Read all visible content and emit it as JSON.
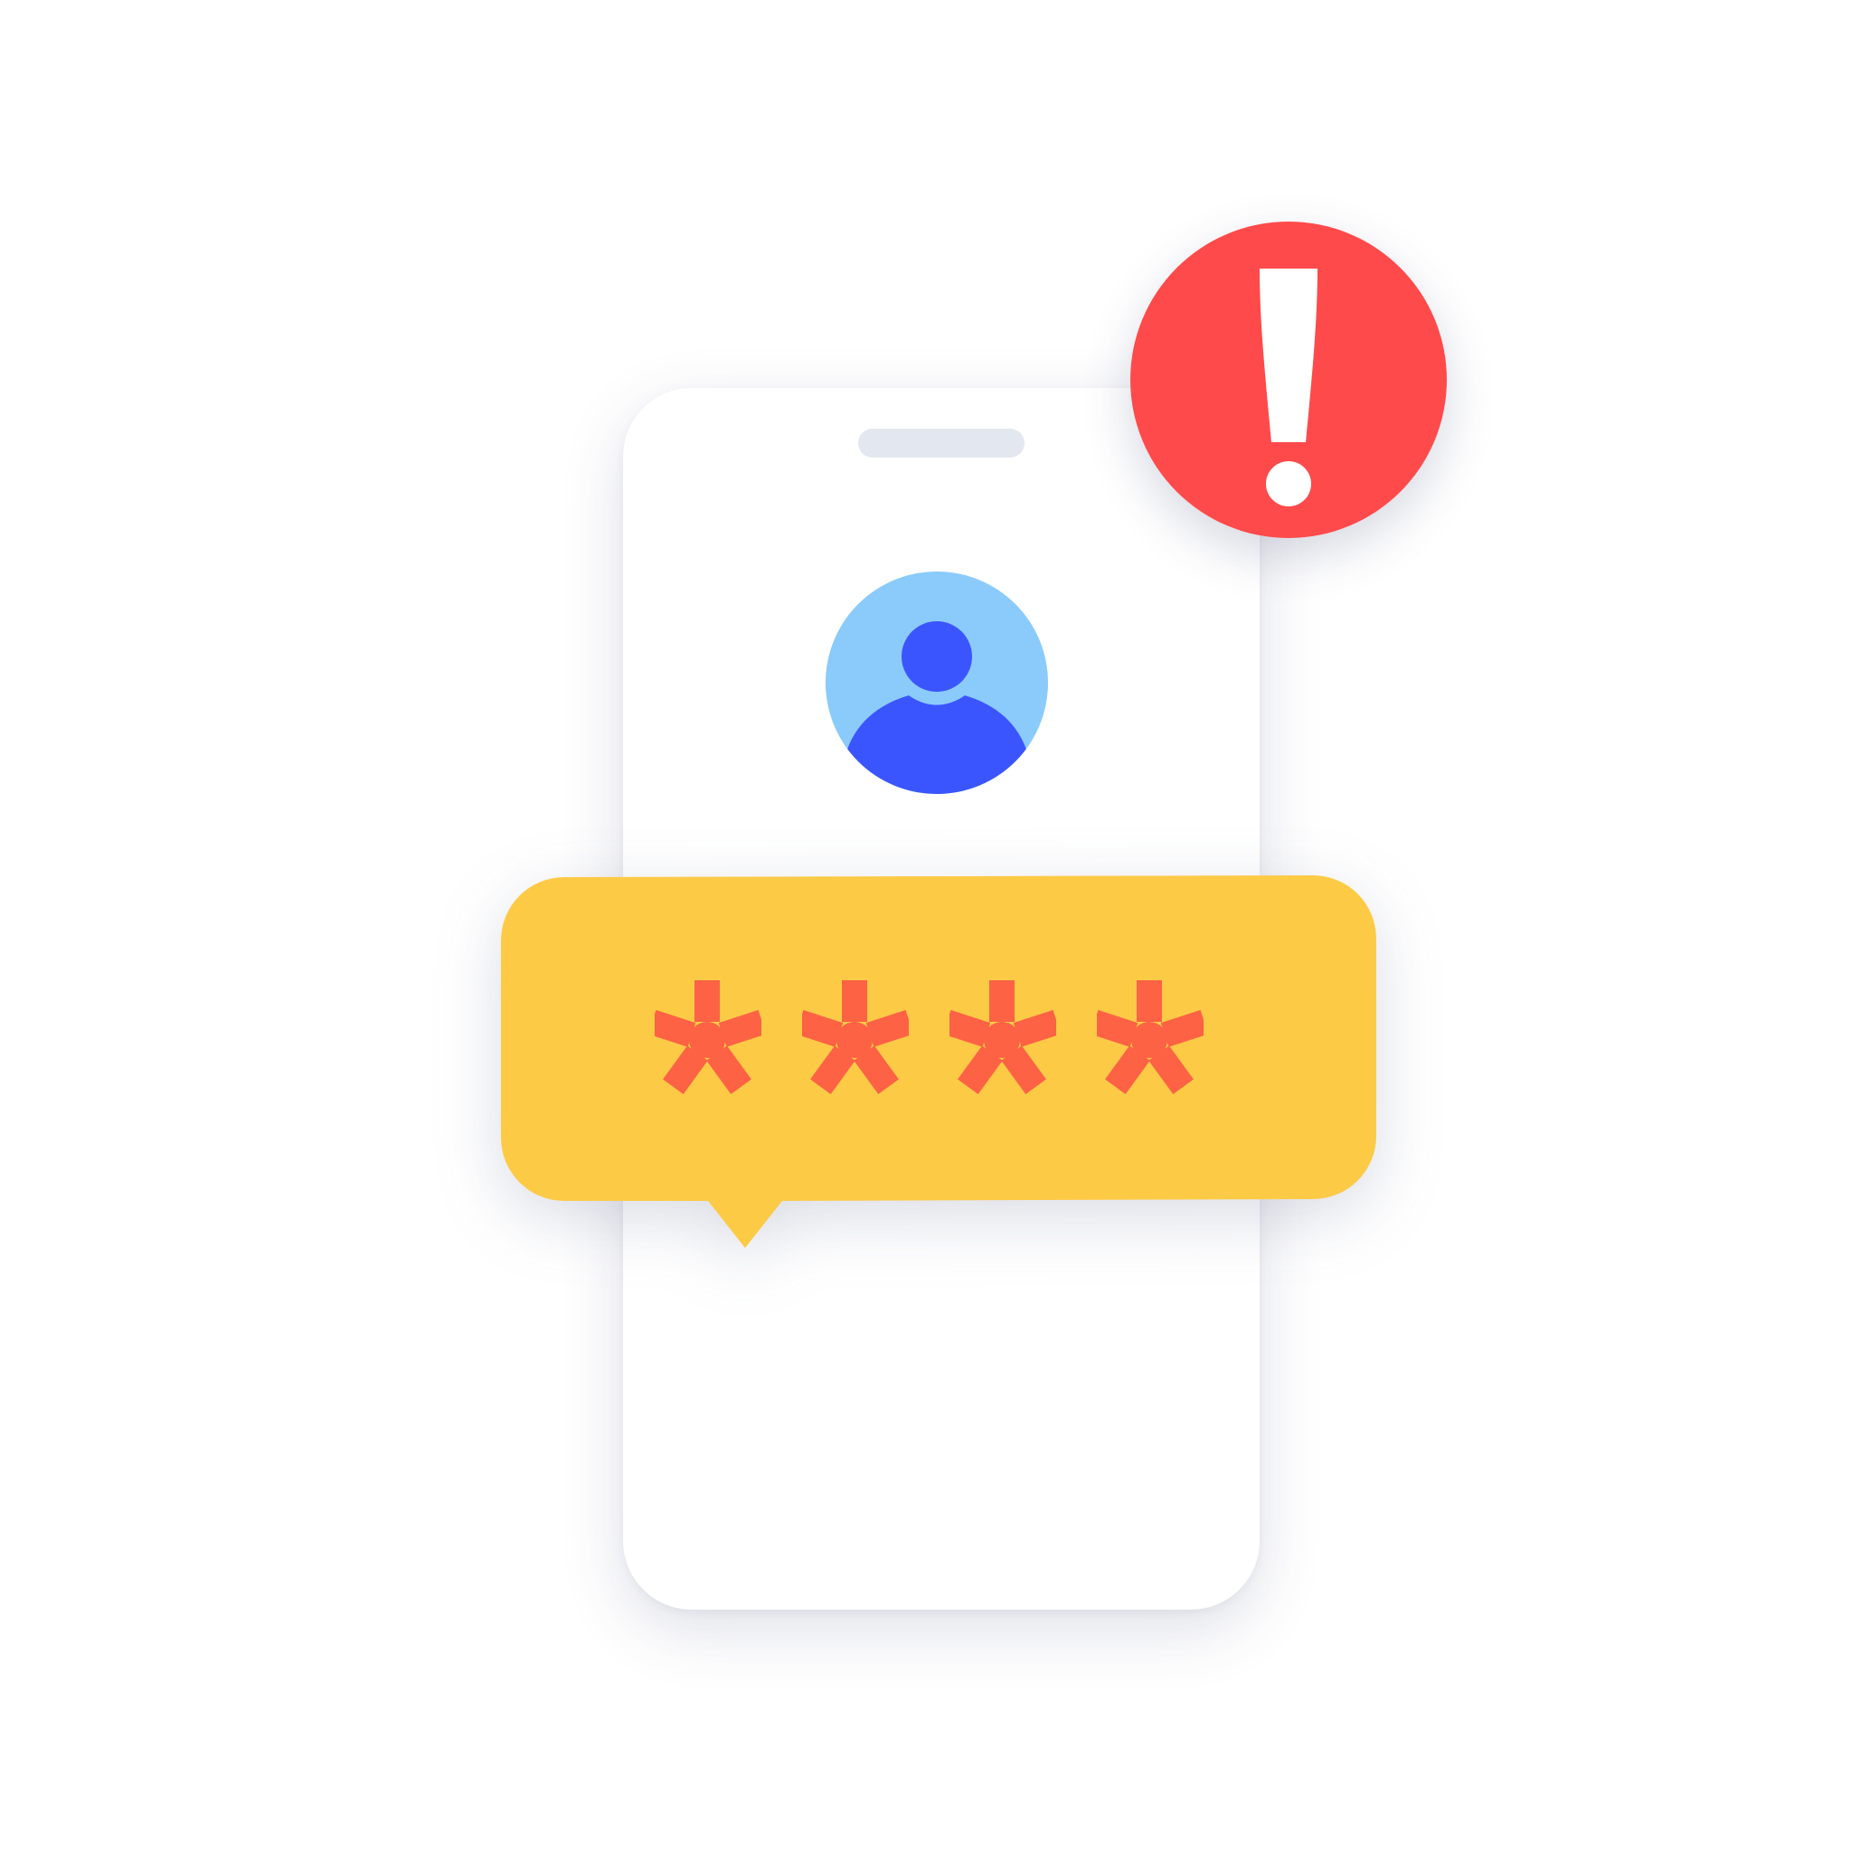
{
  "password_field": {
    "masked_value": "****",
    "mask_chars": [
      "*",
      "*",
      "*",
      "*"
    ]
  },
  "icons": {
    "alert": "exclamation-icon",
    "avatar": "user-avatar-icon",
    "mask": "asterisk-icon"
  },
  "colors": {
    "background": "#ffffff",
    "phone_body": "#ffffff",
    "speaker": "#e3e8f0",
    "avatar_bg": "#8acbfc",
    "avatar_figure": "#3b55fe",
    "bubble": "#fdca46",
    "asterisk": "#fd6244",
    "alert": "#fe4a4b",
    "alert_glyph": "#ffffff"
  }
}
